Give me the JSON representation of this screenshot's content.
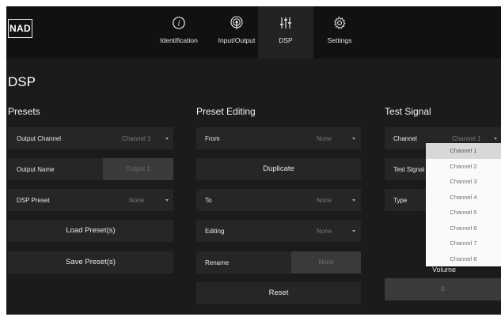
{
  "brand": {
    "logo": "NAD"
  },
  "nav": {
    "tabs": [
      {
        "label": "Identification",
        "icon": "info-icon"
      },
      {
        "label": "Input/Output",
        "icon": "signal-icon"
      },
      {
        "label": "DSP",
        "icon": "equalizer-icon",
        "active": true
      },
      {
        "label": "Settings",
        "icon": "gear-icon"
      }
    ]
  },
  "page": {
    "title": "DSP"
  },
  "presets": {
    "title": "Presets",
    "output_channel": {
      "label": "Output Channel",
      "value": "Channel 1"
    },
    "output_name": {
      "label": "Output Name",
      "value": "Output 1"
    },
    "dsp_preset": {
      "label": "DSP Preset",
      "value": "None"
    },
    "load_button": "Load Preset(s)",
    "save_button": "Save Preset(s)"
  },
  "preset_editing": {
    "title": "Preset Editing",
    "from": {
      "label": "From",
      "value": "None"
    },
    "duplicate_button": "Duplicate",
    "to": {
      "label": "To",
      "value": "None"
    },
    "editing": {
      "label": "Editing",
      "value": "None"
    },
    "rename": {
      "label": "Rename",
      "value": "None"
    },
    "reset_button": "Reset"
  },
  "test_signal": {
    "title": "Test Signal",
    "channel": {
      "label": "Channel",
      "value": "Channel 1"
    },
    "test_signal_label": "Test Signal",
    "type_label": "Type",
    "volume_label": "Volume",
    "volume_value": "0",
    "dropdown_options": [
      "Channel 1",
      "Channel 2",
      "Channel 3",
      "Channel 4",
      "Channel 5",
      "Channel 6",
      "Channel 7",
      "Channel 8"
    ],
    "selected_option_index": 0
  },
  "colors": {
    "background": "#1b1b1b",
    "topbar": "#111111",
    "row": "#262626",
    "accent_dropdown": "#fafafa"
  }
}
